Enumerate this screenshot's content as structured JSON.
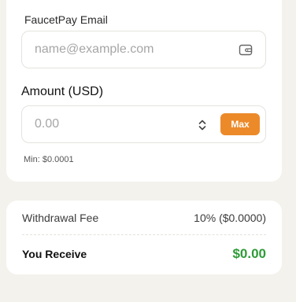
{
  "form": {
    "email_label": "FaucetPay Email",
    "email_placeholder": "name@example.com",
    "email_value": "",
    "amount_label": "Amount (USD)",
    "amount_placeholder": "0.00",
    "amount_value": "",
    "max_label": "Max",
    "min_note": "Min: $0.0001",
    "wallet_icon": "wallet-icon",
    "stepper_icon": "chevron-up-down-icon"
  },
  "summary": {
    "fee_label": "Withdrawal Fee",
    "fee_value": "10% ($0.0000)",
    "receive_label": "You Receive",
    "receive_value": "$0.00"
  },
  "colors": {
    "background": "#f3f2ec",
    "card": "#ffffff",
    "accent": "#ec8a2a",
    "success": "#2e9b38"
  }
}
